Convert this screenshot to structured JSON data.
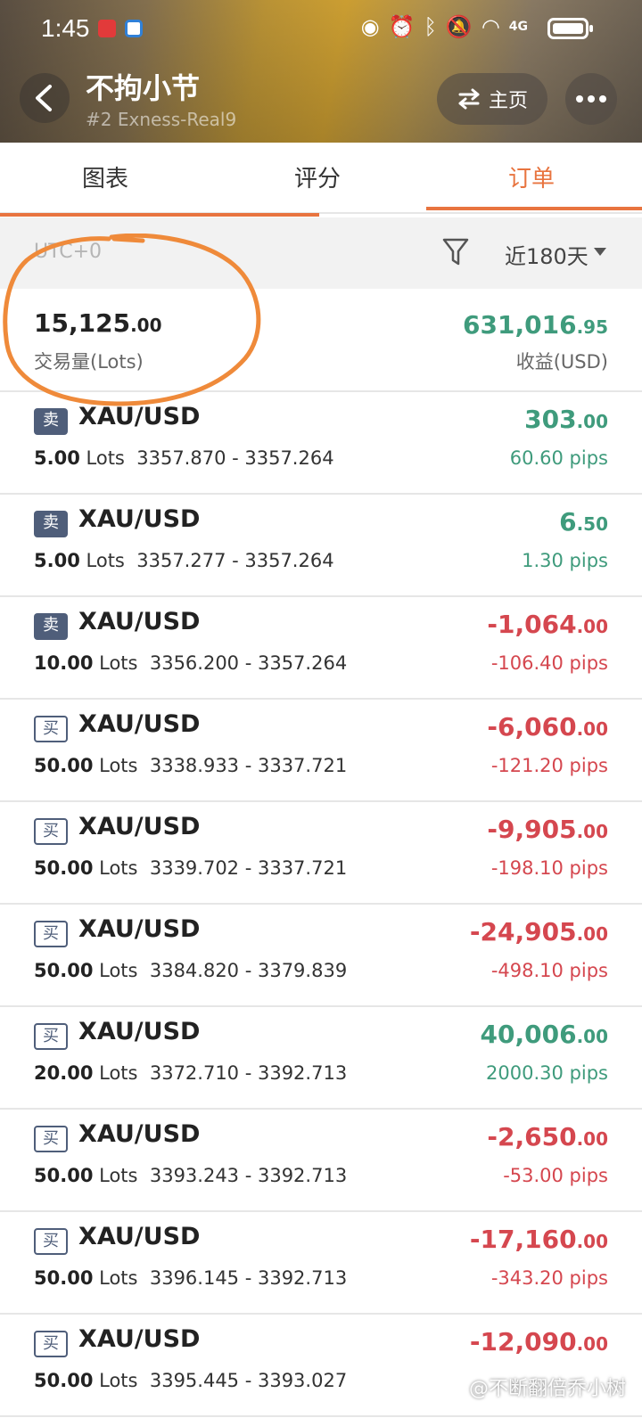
{
  "status_bar": {
    "time": "1:45",
    "network": "4G"
  },
  "header": {
    "title": "不拘小节",
    "subtitle": "#2 Exness-Real9",
    "home_label": "主页"
  },
  "tabs": [
    {
      "label": "图表"
    },
    {
      "label": "评分"
    },
    {
      "label": "订单"
    }
  ],
  "filter": {
    "timezone": "UTC+0",
    "range": "近180天"
  },
  "summary": {
    "volume_int": "15,125",
    "volume_dec": ".00",
    "volume_label": "交易量(Lots)",
    "profit_int": "631,016",
    "profit_dec": ".95",
    "profit_label": "收益(USD)"
  },
  "orders": [
    {
      "side": "卖",
      "symbol": "XAU/USD",
      "lots": "5.00",
      "lots_unit": "Lots",
      "prices": "3357.870 - 3357.264",
      "pl_int": "303",
      "pl_dec": ".00",
      "pips": "60.60 pips",
      "positive": true
    },
    {
      "side": "卖",
      "symbol": "XAU/USD",
      "lots": "5.00",
      "lots_unit": "Lots",
      "prices": "3357.277 - 3357.264",
      "pl_int": "6",
      "pl_dec": ".50",
      "pips": "1.30 pips",
      "positive": true
    },
    {
      "side": "卖",
      "symbol": "XAU/USD",
      "lots": "10.00",
      "lots_unit": "Lots",
      "prices": "3356.200 - 3357.264",
      "pl_int": "-1,064",
      "pl_dec": ".00",
      "pips": "-106.40 pips",
      "positive": false
    },
    {
      "side": "买",
      "symbol": "XAU/USD",
      "lots": "50.00",
      "lots_unit": "Lots",
      "prices": "3338.933 - 3337.721",
      "pl_int": "-6,060",
      "pl_dec": ".00",
      "pips": "-121.20 pips",
      "positive": false
    },
    {
      "side": "买",
      "symbol": "XAU/USD",
      "lots": "50.00",
      "lots_unit": "Lots",
      "prices": "3339.702 - 3337.721",
      "pl_int": "-9,905",
      "pl_dec": ".00",
      "pips": "-198.10 pips",
      "positive": false
    },
    {
      "side": "买",
      "symbol": "XAU/USD",
      "lots": "50.00",
      "lots_unit": "Lots",
      "prices": "3384.820 - 3379.839",
      "pl_int": "-24,905",
      "pl_dec": ".00",
      "pips": "-498.10 pips",
      "positive": false
    },
    {
      "side": "买",
      "symbol": "XAU/USD",
      "lots": "20.00",
      "lots_unit": "Lots",
      "prices": "3372.710 - 3392.713",
      "pl_int": "40,006",
      "pl_dec": ".00",
      "pips": "2000.30 pips",
      "positive": true
    },
    {
      "side": "买",
      "symbol": "XAU/USD",
      "lots": "50.00",
      "lots_unit": "Lots",
      "prices": "3393.243 - 3392.713",
      "pl_int": "-2,650",
      "pl_dec": ".00",
      "pips": "-53.00 pips",
      "positive": false
    },
    {
      "side": "买",
      "symbol": "XAU/USD",
      "lots": "50.00",
      "lots_unit": "Lots",
      "prices": "3396.145 - 3392.713",
      "pl_int": "-17,160",
      "pl_dec": ".00",
      "pips": "-343.20 pips",
      "positive": false
    },
    {
      "side": "买",
      "symbol": "XAU/USD",
      "lots": "50.00",
      "lots_unit": "Lots",
      "prices": "3395.445 - 3393.027",
      "pl_int": "-12,090",
      "pl_dec": ".00",
      "pips": "",
      "positive": false
    }
  ],
  "watermark": "@不断翻倍乔小树",
  "colors": {
    "accent": "#e8743f",
    "profit": "#3f9b7c",
    "loss": "#d5474f",
    "side_badge": "#4f5e7a"
  }
}
